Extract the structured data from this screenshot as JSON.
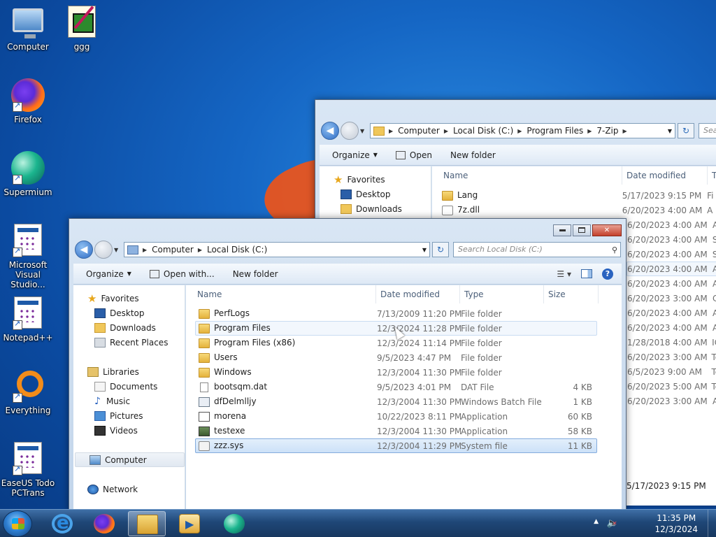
{
  "desktop": {
    "icons": [
      {
        "label": "Computer",
        "icon": "computer-icon"
      },
      {
        "label": "ggg",
        "icon": "image-file-icon"
      },
      {
        "label": "Firefox",
        "icon": "firefox-icon"
      },
      {
        "label": "Supermium",
        "icon": "supermium-icon"
      },
      {
        "label": "Microsoft Visual Studio...",
        "icon": "application-icon"
      },
      {
        "label": "Notepad++",
        "icon": "application-icon"
      },
      {
        "label": "Everything",
        "icon": "everything-icon"
      },
      {
        "label": "EaseUS Todo PCTrans",
        "icon": "application-icon"
      }
    ]
  },
  "back_window": {
    "address": [
      "Computer",
      "Local Disk (C:)",
      "Program Files",
      "7-Zip"
    ],
    "search_placeholder": "Sea",
    "toolbar": {
      "organize": "Organize",
      "open": "Open",
      "new_folder": "New folder"
    },
    "nav": {
      "favorites": "Favorites",
      "desktop": "Desktop",
      "downloads": "Downloads"
    },
    "columns": {
      "name": "Name",
      "date": "Date modified",
      "type": "Ty"
    },
    "files": [
      {
        "name": "Lang",
        "date": "5/17/2023 9:15 PM",
        "type": "Fi"
      },
      {
        "name": "7z.dll",
        "date": "6/20/2023 4:00 AM",
        "type": "A"
      }
    ],
    "partial_rows": [
      {
        "date": "6/20/2023 4:00 AM",
        "type": "A"
      },
      {
        "date": "6/20/2023 4:00 AM",
        "type": "SI"
      },
      {
        "date": "6/20/2023 4:00 AM",
        "type": "SI"
      },
      {
        "date": "6/20/2023 4:00 AM",
        "type": "A"
      },
      {
        "date": "6/20/2023 4:00 AM",
        "type": "A"
      },
      {
        "date": "6/20/2023 3:00 AM",
        "type": "C"
      },
      {
        "date": "6/20/2023 4:00 AM",
        "type": "A"
      },
      {
        "date": "6/20/2023 4:00 AM",
        "type": "A"
      },
      {
        "date": "1/28/2018 4:00 AM",
        "type": "IC"
      },
      {
        "date": "6/20/2023 3:00 AM",
        "type": "Te"
      },
      {
        "date": "6/5/2023 9:00 AM",
        "type": "Te"
      },
      {
        "date": "6/20/2023 5:00 AM",
        "type": "Te"
      },
      {
        "date": "6/20/2023 3:00 AM",
        "type": "A"
      }
    ],
    "status_date": "5/17/2023 9:15 PM"
  },
  "front_window": {
    "address": [
      "Computer",
      "Local Disk (C:)"
    ],
    "search_placeholder": "Search Local Disk (C:)",
    "toolbar": {
      "organize": "Organize",
      "open_with": "Open with...",
      "new_folder": "New folder"
    },
    "nav": {
      "favorites": "Favorites",
      "desktop": "Desktop",
      "downloads": "Downloads",
      "recent_places": "Recent Places",
      "libraries": "Libraries",
      "documents": "Documents",
      "music": "Music",
      "pictures": "Pictures",
      "videos": "Videos",
      "computer": "Computer",
      "network": "Network"
    },
    "columns": {
      "name": "Name",
      "date": "Date modified",
      "type": "Type",
      "size": "Size"
    },
    "files": [
      {
        "name": "PerfLogs",
        "date": "7/13/2009 11:20 PM",
        "type": "File folder",
        "size": "",
        "icon": "folder"
      },
      {
        "name": "Program Files",
        "date": "12/3/2024 11:28 PM",
        "type": "File folder",
        "size": "",
        "icon": "folder"
      },
      {
        "name": "Program Files (x86)",
        "date": "12/3/2024 11:14 PM",
        "type": "File folder",
        "size": "",
        "icon": "folder"
      },
      {
        "name": "Users",
        "date": "9/5/2023 4:47 PM",
        "type": "File folder",
        "size": "",
        "icon": "folder"
      },
      {
        "name": "Windows",
        "date": "12/3/2004 11:30 PM",
        "type": "File folder",
        "size": "",
        "icon": "folder"
      },
      {
        "name": "bootsqm.dat",
        "date": "9/5/2023 4:01 PM",
        "type": "DAT File",
        "size": "4 KB",
        "icon": "file"
      },
      {
        "name": "dfDelmlljy",
        "date": "12/3/2004 11:30 PM",
        "type": "Windows Batch File",
        "size": "1 KB",
        "icon": "bat"
      },
      {
        "name": "morena",
        "date": "10/22/2023 8:11 PM",
        "type": "Application",
        "size": "60 KB",
        "icon": "app"
      },
      {
        "name": "testexe",
        "date": "12/3/2004 11:30 PM",
        "type": "Application",
        "size": "58 KB",
        "icon": "exe"
      },
      {
        "name": "zzz.sys",
        "date": "12/3/2004 11:29 PM",
        "type": "System file",
        "size": "11 KB",
        "icon": "sys"
      }
    ]
  },
  "taskbar": {
    "time": "11:35 PM",
    "date": "12/3/2024"
  }
}
